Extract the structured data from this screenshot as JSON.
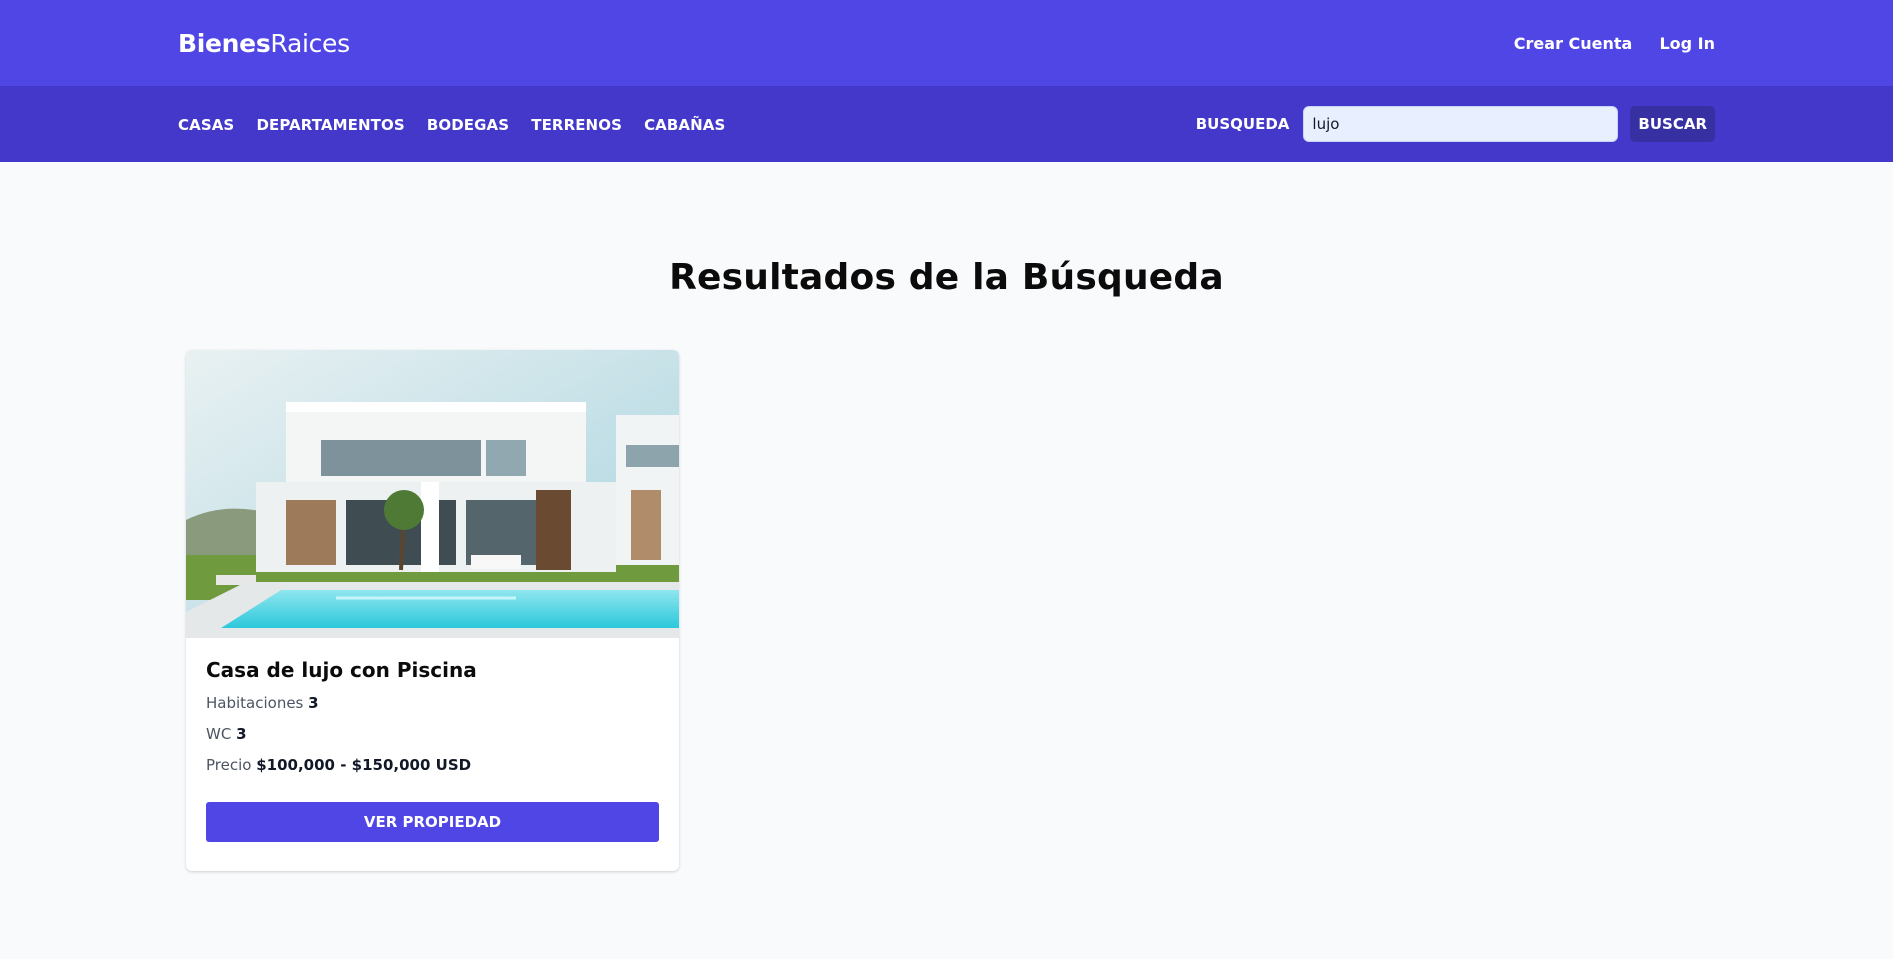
{
  "header": {
    "logo_bold": "Bienes",
    "logo_light": "Raices",
    "create_account": "Crear Cuenta",
    "login": "Log In"
  },
  "nav": {
    "items": [
      "CASAS",
      "DEPARTAMENTOS",
      "BODEGAS",
      "TERRENOS",
      "CABAÑAS"
    ],
    "search_label": "BUSQUEDA",
    "search_value": "lujo",
    "search_button": "BUSCAR"
  },
  "main": {
    "title": "Resultados de la Búsqueda",
    "results": [
      {
        "title": "Casa de lujo con Piscina",
        "rooms_label": "Habitaciones",
        "rooms": "3",
        "wc_label": "WC",
        "wc": "3",
        "price_label": "Precio",
        "price": "$100,000 - $150,000 USD",
        "button": "VER PROPIEDAD"
      }
    ]
  },
  "colors": {
    "header": "#4f46e5",
    "navbar": "#4338ca",
    "search_button": "#3730a3",
    "accent": "#4f46e5",
    "background": "#f8fafc"
  }
}
